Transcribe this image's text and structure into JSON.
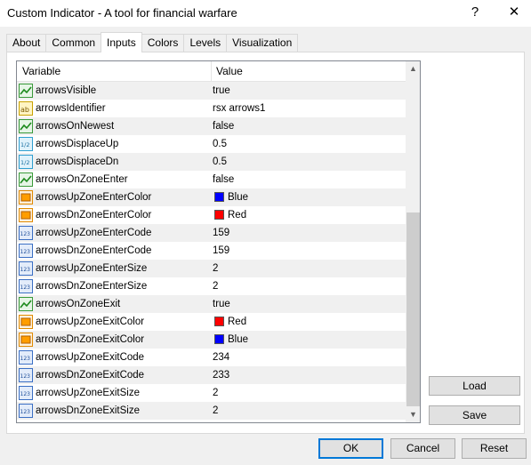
{
  "window": {
    "title": "Custom Indicator - A tool for financial warfare",
    "help_glyph": "?",
    "close_glyph": "✕"
  },
  "tabs": [
    {
      "label": "About"
    },
    {
      "label": "Common"
    },
    {
      "label": "Inputs",
      "active": true
    },
    {
      "label": "Colors"
    },
    {
      "label": "Levels"
    },
    {
      "label": "Visualization"
    }
  ],
  "grid": {
    "col_variable": "Variable",
    "col_value": "Value",
    "rows": [
      {
        "type": "bool",
        "name": "arrowsVisible",
        "value": "true"
      },
      {
        "type": "string",
        "name": "arrowsIdentifier",
        "value": "rsx arrows1"
      },
      {
        "type": "bool",
        "name": "arrowsOnNewest",
        "value": "false"
      },
      {
        "type": "double",
        "name": "arrowsDisplaceUp",
        "value": "0.5"
      },
      {
        "type": "double",
        "name": "arrowsDisplaceDn",
        "value": "0.5"
      },
      {
        "type": "bool",
        "name": "arrowsOnZoneEnter",
        "value": "false"
      },
      {
        "type": "color",
        "name": "arrowsUpZoneEnterColor",
        "value": "Blue",
        "color": "#0000ff"
      },
      {
        "type": "color",
        "name": "arrowsDnZoneEnterColor",
        "value": "Red",
        "color": "#ff0000"
      },
      {
        "type": "int",
        "name": "arrowsUpZoneEnterCode",
        "value": "159"
      },
      {
        "type": "int",
        "name": "arrowsDnZoneEnterCode",
        "value": "159"
      },
      {
        "type": "int",
        "name": "arrowsUpZoneEnterSize",
        "value": "2"
      },
      {
        "type": "int",
        "name": "arrowsDnZoneEnterSize",
        "value": "2"
      },
      {
        "type": "bool",
        "name": "arrowsOnZoneExit",
        "value": "true"
      },
      {
        "type": "color",
        "name": "arrowsUpZoneExitColor",
        "value": "Red",
        "color": "#ff0000"
      },
      {
        "type": "color",
        "name": "arrowsDnZoneExitColor",
        "value": "Blue",
        "color": "#0000ff"
      },
      {
        "type": "int",
        "name": "arrowsUpZoneExitCode",
        "value": "234"
      },
      {
        "type": "int",
        "name": "arrowsDnZoneExitCode",
        "value": "233"
      },
      {
        "type": "int",
        "name": "arrowsUpZoneExitSize",
        "value": "2"
      },
      {
        "type": "int",
        "name": "arrowsDnZoneExitSize",
        "value": "2"
      }
    ]
  },
  "side_buttons": {
    "load": "Load",
    "save": "Save"
  },
  "footer_buttons": {
    "ok": "OK",
    "cancel": "Cancel",
    "reset": "Reset"
  },
  "icons": {
    "bool": "bool-icon",
    "string": "string-icon",
    "double": "double-icon",
    "color": "color-icon",
    "int": "int-icon"
  }
}
